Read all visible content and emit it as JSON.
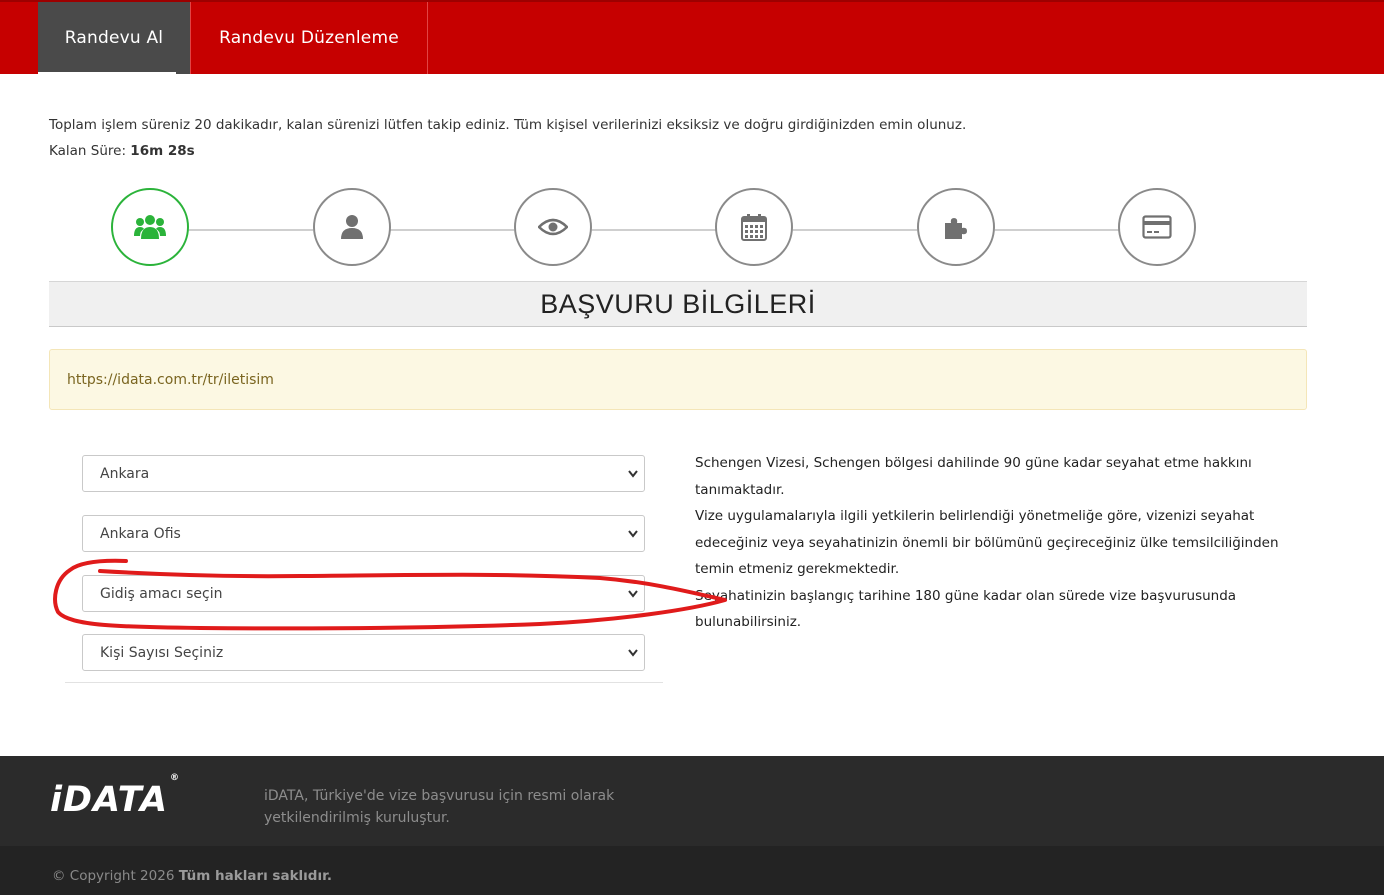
{
  "nav": {
    "items": [
      {
        "label": "Randevu Al",
        "active": true
      },
      {
        "label": "Randevu Düzenleme",
        "active": false
      }
    ],
    "bg_color": "#c60000",
    "active_bg_color": "#4a4a4a"
  },
  "info": {
    "message": "Toplam işlem süreniz 20 dakikadır, kalan sürenizi lütfen takip ediniz. Tüm kişisel verilerinizi eksiksiz ve doğru girdiğinizden emin olunuz.",
    "timer_label": "Kalan Süre:",
    "timer_value": "16m 28s"
  },
  "steps": [
    {
      "icon": "users-icon",
      "active": true
    },
    {
      "icon": "user-icon",
      "active": false
    },
    {
      "icon": "eye-icon",
      "active": false
    },
    {
      "icon": "calendar-icon",
      "active": false
    },
    {
      "icon": "puzzle-icon",
      "active": false
    },
    {
      "icon": "credit-card-icon",
      "active": false
    }
  ],
  "section": {
    "title": "BAŞVURU BİLGİLERİ"
  },
  "alert": {
    "text": "https://idata.com.tr/tr/iletisim"
  },
  "form": {
    "city_select": "Ankara",
    "office_select": "Ankara Ofis",
    "purpose_select": "Gidiş amacı seçin",
    "people_select": "Kişi Sayısı Seçiniz"
  },
  "description": {
    "line1": "Schengen Vizesi, Schengen bölgesi dahilinde 90 güne kadar seyahat etme hakkını tanımaktadır.",
    "line2": "Vize uygulamalarıyla ilgili yetkilerin belirlendiği yönetmeliğe göre, vizenizi seyahat edeceğiniz veya seyahatinizin önemli bir bölümünü geçireceğiniz ülke temsilciliğinden temin etmeniz gerekmektedir.",
    "line3": "Seyahatinizin başlangıç tarihine 180 güne kadar olan sürede vize başvurusunda bulunabilirsiniz."
  },
  "footer": {
    "logo": "iDATA",
    "logo_mark": "®",
    "description": "iDATA, Türkiye'de vize başvurusu için resmi olarak yetkilendirilmiş kuruluştur.",
    "copyright_prefix": "© Copyright 2026",
    "copyright_bold": "Tüm hakları saklıdır."
  },
  "colors": {
    "accent_red": "#c60000",
    "step_active": "#2bb33a",
    "annotation_red": "#e01b1b"
  }
}
